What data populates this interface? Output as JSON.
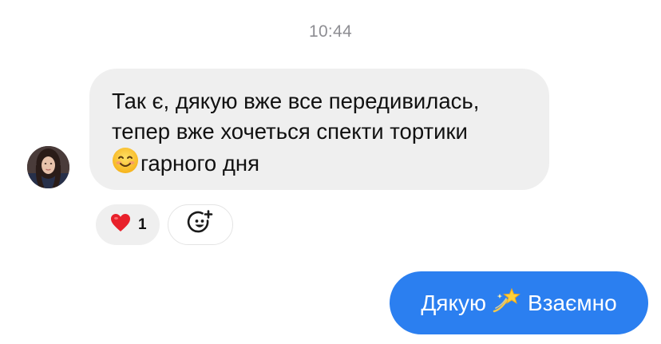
{
  "conversation": {
    "timestamp": "10:44",
    "incoming_message": {
      "sender_avatar_icon": "contact-avatar",
      "lines": [
        "Так є, дякую вже все передивилась,",
        "тепер вже хочеться спекти тортики"
      ],
      "last_line_emoji": "smiling-face-emoji",
      "last_line_text": "гарного дня",
      "reaction": {
        "emoji": "red-heart-icon",
        "count": "1"
      },
      "add_reaction_icon": "add-reaction-icon"
    },
    "outgoing_message": {
      "text_before": "Дякую",
      "emoji": "dizzy-star-emoji",
      "text_after": "Взаємно"
    }
  },
  "colors": {
    "incoming_bubble": "#efefef",
    "outgoing_bubble": "#2b7ff0",
    "timestamp": "#8e8e93",
    "heart": "#e8202a"
  }
}
